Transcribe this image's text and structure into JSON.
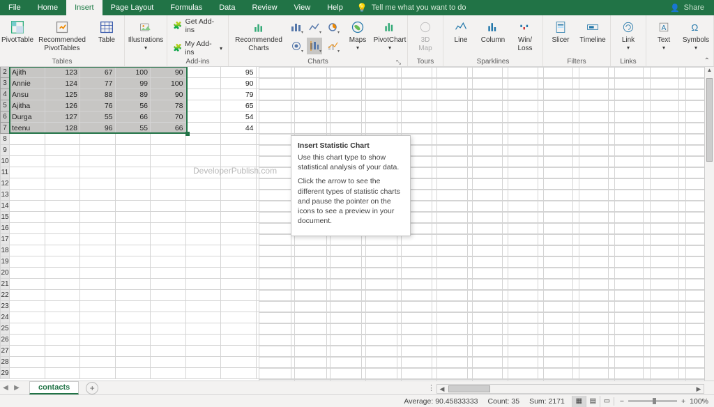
{
  "tabs": {
    "file": "File",
    "home": "Home",
    "insert": "Insert",
    "page_layout": "Page Layout",
    "formulas": "Formulas",
    "data": "Data",
    "review": "Review",
    "view": "View",
    "help": "Help"
  },
  "tellme": "Tell me what you want to do",
  "share": "Share",
  "ribbon": {
    "pivottable": "PivotTable",
    "rec_pivot": "Recommended\nPivotTables",
    "table": "Table",
    "illustrations": "Illustrations",
    "get_addins": "Get Add-ins",
    "my_addins": "My Add-ins",
    "rec_charts": "Recommended\nCharts",
    "maps": "Maps",
    "pivotchart": "PivotChart",
    "3dmap": "3D\nMap",
    "line": "Line",
    "column": "Column",
    "winloss": "Win/\nLoss",
    "slicer": "Slicer",
    "timeline": "Timeline",
    "link": "Link",
    "text": "Text",
    "symbols": "Symbols",
    "groups": {
      "tables": "Tables",
      "addins": "Add-ins",
      "charts": "Charts",
      "tours": "Tours",
      "sparklines": "Sparklines",
      "filters": "Filters",
      "links": "Links"
    }
  },
  "tooltip": {
    "title": "Insert Statistic Chart",
    "p1": "Use this chart type to show statistical analysis of your data.",
    "p2": "Click the arrow to see the different types of statistic charts and pause the pointer on the icons to see a preview in your document."
  },
  "rows": [
    {
      "n": 2,
      "name": "Ajith",
      "c": [
        123,
        67,
        100,
        90,
        "",
        95
      ]
    },
    {
      "n": 3,
      "name": "Annie",
      "c": [
        124,
        77,
        99,
        100,
        "",
        90
      ]
    },
    {
      "n": 4,
      "name": "Ansu",
      "c": [
        125,
        88,
        89,
        90,
        "",
        79
      ]
    },
    {
      "n": 5,
      "name": "Ajitha",
      "c": [
        126,
        76,
        56,
        78,
        "",
        65
      ]
    },
    {
      "n": 6,
      "name": "Durga",
      "c": [
        127,
        55,
        66,
        70,
        "",
        54
      ]
    },
    {
      "n": 7,
      "name": "teenu",
      "c": [
        128,
        96,
        55,
        66,
        "",
        44
      ]
    }
  ],
  "empty_rows": [
    8,
    9,
    10,
    11,
    12,
    13,
    14,
    15,
    16,
    17,
    18,
    19,
    20,
    21,
    22,
    23,
    24,
    25,
    26,
    27,
    28,
    29
  ],
  "watermark": "DeveloperPublish.com",
  "sheet_tab": "contacts",
  "status": {
    "average_lbl": "Average:",
    "average": "90.45833333",
    "count_lbl": "Count:",
    "count": "35",
    "sum_lbl": "Sum:",
    "sum": "2171",
    "zoom": "100%"
  }
}
